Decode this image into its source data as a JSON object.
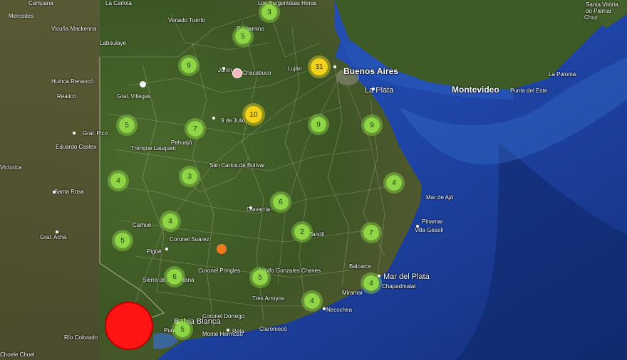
{
  "places": [
    {
      "id": "campana-top",
      "label": "Campana"
    },
    {
      "id": "la-carlota",
      "label": "La Carlota"
    },
    {
      "id": "los-surgentes",
      "label": "Los Surgentes"
    },
    {
      "id": "las-heras",
      "label": "Las Heras"
    },
    {
      "id": "mercedes",
      "label": "Mercedes"
    },
    {
      "id": "venado-tuerto",
      "label": "Venado Tuerto"
    },
    {
      "id": "vicuna-mackenna",
      "label": "Vicuña Mackenna"
    },
    {
      "id": "laboulaye",
      "label": "Laboulaye"
    },
    {
      "id": "pergamino",
      "label": "Pergamino"
    },
    {
      "id": "junin",
      "label": "Junín"
    },
    {
      "id": "chacabuco",
      "label": "Chacabuco"
    },
    {
      "id": "lujan",
      "label": "Luján"
    },
    {
      "id": "buenos-aires",
      "label": "Buenos Aires"
    },
    {
      "id": "la-plata",
      "label": "La Plata"
    },
    {
      "id": "huinca-renanco",
      "label": "Huinca Renancó"
    },
    {
      "id": "realico",
      "label": "Realicó"
    },
    {
      "id": "gral-villegas",
      "label": "Gral. Villegas"
    },
    {
      "id": "gral-pico",
      "label": "Gral. Pico"
    },
    {
      "id": "eduardo-castex",
      "label": "Eduardo Castex"
    },
    {
      "id": "trenque-lauquen",
      "label": "Trenque Lauquen"
    },
    {
      "id": "pehuajo",
      "label": "Pehuajó"
    },
    {
      "id": "9-de-julio",
      "label": "9 de Julio"
    },
    {
      "id": "san-carlos",
      "label": "San Carlos de Bolívar"
    },
    {
      "id": "victorica",
      "label": "Victorica"
    },
    {
      "id": "santa-rosa",
      "label": "Santa Rosa"
    },
    {
      "id": "carhue",
      "label": "Carhué"
    },
    {
      "id": "gral-acha",
      "label": "Gral. Acha"
    },
    {
      "id": "coronel-suarez",
      "label": "Coronel Suárez"
    },
    {
      "id": "pigue",
      "label": "Pigüé"
    },
    {
      "id": "olavarria",
      "label": "Olavarría"
    },
    {
      "id": "tandil",
      "label": "Tandil"
    },
    {
      "id": "coronel-pringles",
      "label": "Coronel Pringles"
    },
    {
      "id": "sierra-de-la-ventana",
      "label": "Sierra de la Ventana"
    },
    {
      "id": "benito-juarez",
      "label": "Adolfo Gonzales Chaves"
    },
    {
      "id": "tres-arroyos",
      "label": "Tres Arroyos"
    },
    {
      "id": "necochea",
      "label": "Necochea"
    },
    {
      "id": "miramar",
      "label": "Miramar"
    },
    {
      "id": "balcarce",
      "label": "Balcarce"
    },
    {
      "id": "mar-del-plata",
      "label": "Mar del Plata"
    },
    {
      "id": "chapadmalal",
      "label": "Chapadmalal"
    },
    {
      "id": "pinamar",
      "label": "Pinamar"
    },
    {
      "id": "villa-gesell",
      "label": "Villa Gesell"
    },
    {
      "id": "mar-de-ajo",
      "label": "Mar de Ajó"
    },
    {
      "id": "bahia-blanca",
      "label": "Bahía Blanca"
    },
    {
      "id": "punta-alta",
      "label": "Punta Alta"
    },
    {
      "id": "coronel-dorrego",
      "label": "Coronel Dorrego"
    },
    {
      "id": "monte-hermoso",
      "label": "Monte Hermoso"
    },
    {
      "id": "reta",
      "label": "Reta"
    },
    {
      "id": "claromeco",
      "label": "Claromecó"
    },
    {
      "id": "rio-colorado",
      "label": "Río Colorado"
    },
    {
      "id": "choele-choel",
      "label": "Choele Choel"
    },
    {
      "id": "montevideo",
      "label": "Montevideo"
    },
    {
      "id": "punta-del-este",
      "label": "Punta del Este"
    },
    {
      "id": "la-paloma",
      "label": "La Paloma"
    },
    {
      "id": "santa-vitoria",
      "label": "Santa Vitória do Palmar"
    },
    {
      "id": "chuy",
      "label": "Chuy"
    }
  ],
  "clusters": [
    {
      "id": "c1",
      "count": "3",
      "color": "green"
    },
    {
      "id": "c2",
      "count": "5",
      "color": "green"
    },
    {
      "id": "c3",
      "count": "9",
      "color": "green"
    },
    {
      "id": "c4",
      "count": "31",
      "color": "yellow"
    },
    {
      "id": "c5",
      "count": "10",
      "color": "yellow"
    },
    {
      "id": "c6",
      "count": "5",
      "color": "green"
    },
    {
      "id": "c7",
      "count": "7",
      "color": "green"
    },
    {
      "id": "c8",
      "count": "9",
      "color": "green"
    },
    {
      "id": "c9",
      "count": "9",
      "color": "green"
    },
    {
      "id": "c10",
      "count": "3",
      "color": "green"
    },
    {
      "id": "c11",
      "count": "4",
      "color": "green"
    },
    {
      "id": "c12",
      "count": "4",
      "color": "green"
    },
    {
      "id": "c13",
      "count": "6",
      "color": "green"
    },
    {
      "id": "c14",
      "count": "4",
      "color": "green"
    },
    {
      "id": "c15",
      "count": "5",
      "color": "green"
    },
    {
      "id": "c16",
      "count": "2",
      "color": "green"
    },
    {
      "id": "c17",
      "count": "7",
      "color": "green"
    },
    {
      "id": "c18",
      "count": "6",
      "color": "green"
    },
    {
      "id": "c19",
      "count": "5",
      "color": "green"
    },
    {
      "id": "c20",
      "count": "4",
      "color": "green"
    },
    {
      "id": "c21",
      "count": "4",
      "color": "green"
    },
    {
      "id": "c22",
      "count": "5",
      "color": "green"
    }
  ],
  "colors": {
    "cluster_green": "#8fd646",
    "cluster_yellow": "#f2d21b",
    "ocean": "#1f45a8",
    "land": "#3f5a26",
    "single_red": "#ff1414",
    "single_orange": "#f07a24",
    "single_pink": "#f4b6bd",
    "single_white": "#f5f5f5"
  }
}
